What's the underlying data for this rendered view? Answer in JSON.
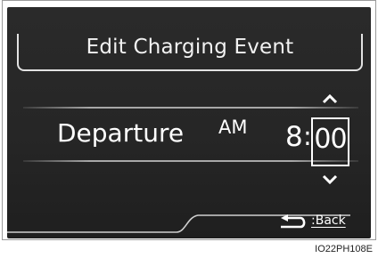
{
  "title": "Edit Charging Event",
  "departure_label": "Departure",
  "ampm": "AM",
  "hour": "8",
  "separator": ":",
  "minute": "00",
  "back_label": ":Back",
  "image_code": "IO22PH108E",
  "icons": [
    "chevron-up-icon",
    "chevron-down-icon",
    "back-arrow-icon"
  ]
}
